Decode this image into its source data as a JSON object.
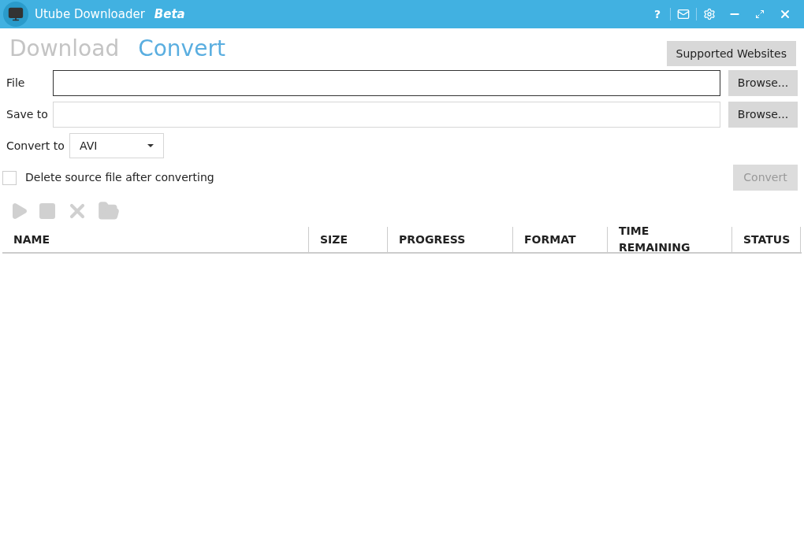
{
  "window": {
    "title": "Utube Downloader",
    "badge": "Beta"
  },
  "title_bar_buttons": [
    {
      "kind": "help",
      "label": "?"
    },
    {
      "kind": "mail"
    },
    {
      "kind": "settings"
    },
    {
      "kind": "minimize"
    },
    {
      "kind": "maximize"
    },
    {
      "kind": "close"
    }
  ],
  "tabs": [
    {
      "label": "Download",
      "selected": false
    },
    {
      "label": "Convert",
      "selected": true
    }
  ],
  "supported_button": "Supported Websites",
  "fields": [
    {
      "label": "File",
      "focused": true,
      "button": "Browse..."
    },
    {
      "label": "Save to",
      "focused": false,
      "button": "Browse..."
    }
  ],
  "convert_to": {
    "label": "Convert to",
    "value": "AVI"
  },
  "delete_source": {
    "label": "Delete source file after converting",
    "checked": false
  },
  "convert_button": {
    "label": "Convert",
    "disabled": true
  },
  "toolbar": [
    {
      "kind": "play",
      "disabled": true
    },
    {
      "kind": "stop",
      "disabled": true
    },
    {
      "kind": "remove",
      "disabled": true
    },
    {
      "kind": "folder",
      "disabled": true
    }
  ],
  "table": {
    "columns": [
      "NAME",
      "SIZE",
      "PROGRESS",
      "FORMAT",
      "TIME REMAINING",
      "STATUS"
    ]
  }
}
